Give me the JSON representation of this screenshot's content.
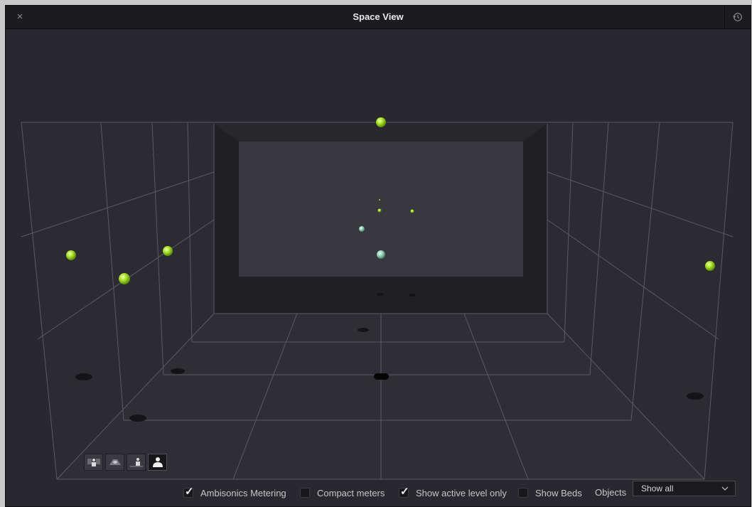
{
  "window": {
    "title": "Space View",
    "close_glyph": "×",
    "close_icon": "close-icon",
    "reset_icon": "reset-history-icon"
  },
  "viewport": {
    "view_toggles": [
      {
        "name": "view-toggle-front-speaker",
        "icon": "front-speaker-view-icon",
        "active": false
      },
      {
        "name": "view-toggle-top-plane",
        "icon": "top-plane-view-icon",
        "active": false
      },
      {
        "name": "view-toggle-side-speaker",
        "icon": "side-speaker-view-icon",
        "active": false
      },
      {
        "name": "view-toggle-listener",
        "icon": "listener-view-icon",
        "active": true
      }
    ],
    "accent_color": "#a6e024",
    "object_color": "#9fd3c0"
  },
  "options": {
    "ambisonics": {
      "label": "Ambisonics Metering",
      "checked": true
    },
    "compact": {
      "label": "Compact meters",
      "checked": false
    },
    "active_level": {
      "label": "Show active level only",
      "checked": true
    },
    "beds": {
      "label": "Show Beds",
      "checked": false
    },
    "objects_label": "Objects",
    "objects_value": "Show all"
  }
}
